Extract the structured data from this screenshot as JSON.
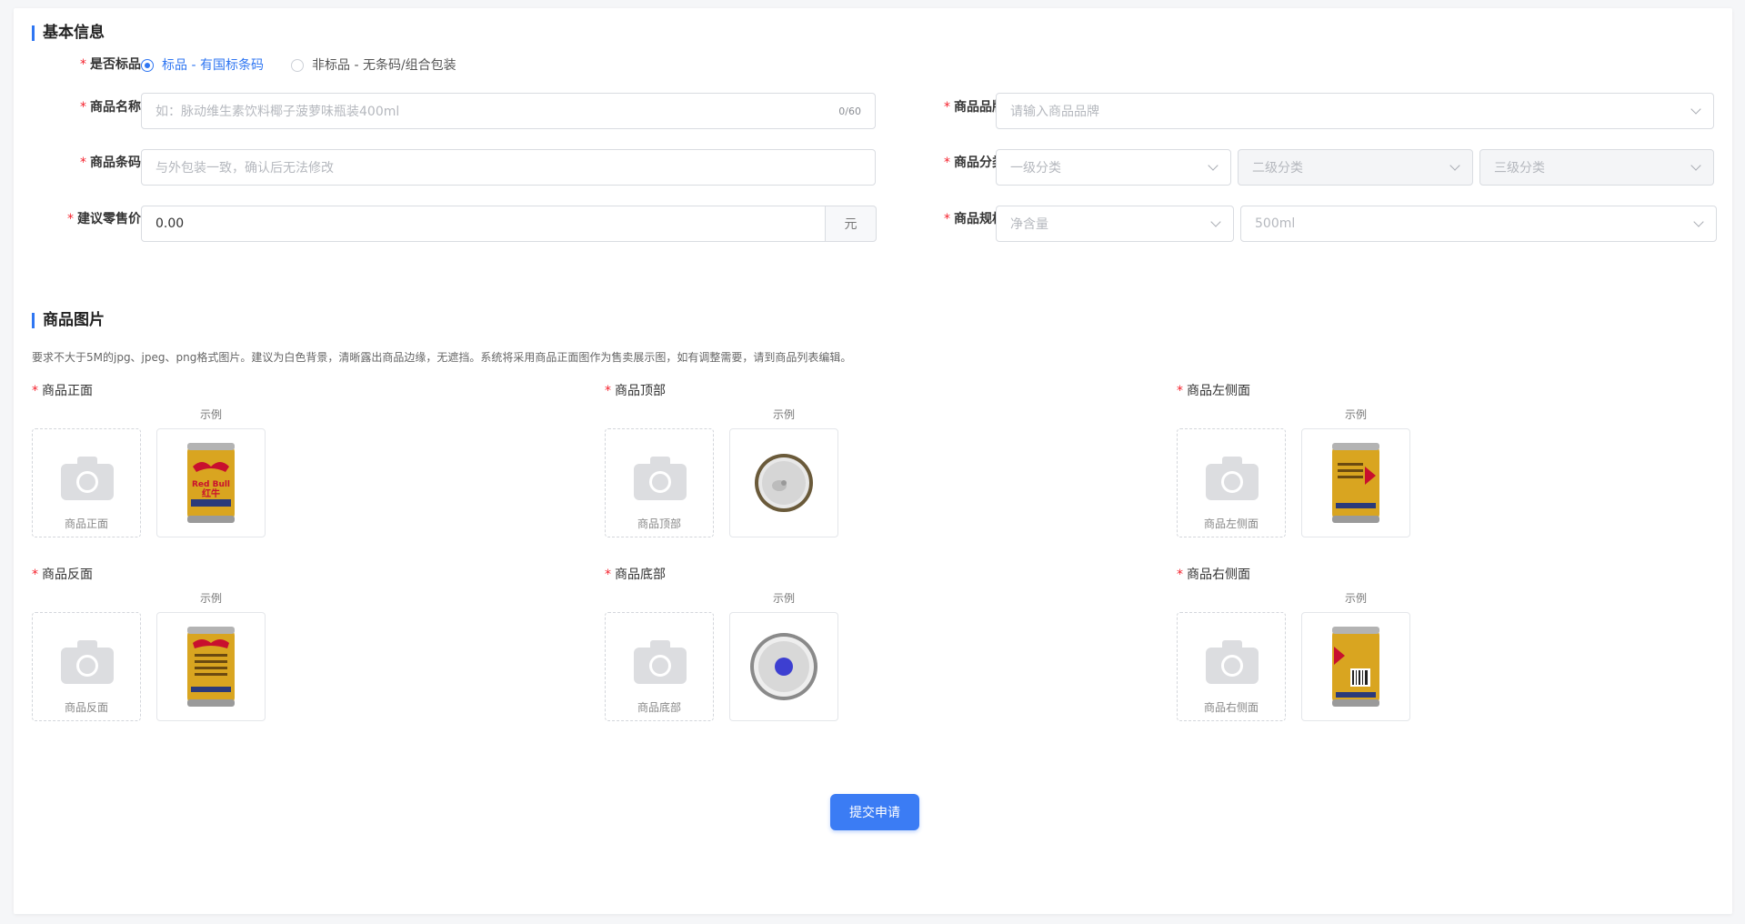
{
  "basic": {
    "title": "基本信息",
    "is_standard": {
      "label": "是否标品",
      "options": [
        "标品 - 有国标条码",
        "非标品 - 无条码/组合包装"
      ]
    },
    "name": {
      "label": "商品名称",
      "placeholder": "如：脉动维生素饮料椰子菠萝味瓶装400ml",
      "count": "0/60"
    },
    "barcode": {
      "label": "商品条码",
      "placeholder": "与外包装一致，确认后无法修改"
    },
    "price": {
      "label": "建议零售价",
      "value": "0.00",
      "unit": "元"
    },
    "brand": {
      "label": "商品品牌",
      "placeholder": "请输入商品品牌"
    },
    "category": {
      "label": "商品分类",
      "level1": "一级分类",
      "level2": "二级分类",
      "level3": "三级分类"
    },
    "spec": {
      "label": "商品规格",
      "type": "净含量",
      "value": "500ml"
    }
  },
  "images": {
    "title": "商品图片",
    "hint": "要求不大于5M的jpg、jpeg、png格式图片。建议为白色背景，清晰露出商品边缘，无遮挡。系统将采用商品正面图作为售卖展示图，如有调整需要，请到商品列表编辑。",
    "example_label": "示例",
    "slots": [
      {
        "label": "商品正面",
        "upload_text": "商品正面"
      },
      {
        "label": "商品顶部",
        "upload_text": "商品顶部"
      },
      {
        "label": "商品左侧面",
        "upload_text": "商品左侧面"
      },
      {
        "label": "商品反面",
        "upload_text": "商品反面"
      },
      {
        "label": "商品底部",
        "upload_text": "商品底部"
      },
      {
        "label": "商品右侧面",
        "upload_text": "商品右侧面"
      }
    ],
    "sample_can_text": [
      "Red Bull",
      "红牛"
    ]
  },
  "actions": {
    "submit": "提交申请"
  },
  "colors": {
    "accent": "#2f76f2",
    "required": "#f5222d",
    "can_gold": "#d9a520",
    "can_red": "#c8102e",
    "bottom_blue": "#3d3fd1"
  }
}
